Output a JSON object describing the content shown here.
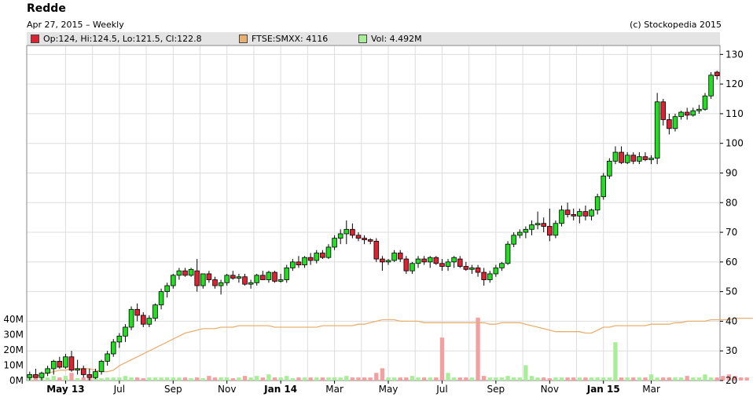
{
  "header": {
    "title": "Redde",
    "subtitle": "Apr 27, 2015 – Weekly",
    "copyright": "(c) Stockopedia 2015"
  },
  "legend": {
    "ohlc": "Op:124, Hi:124.5, Lo:121.5, Cl:122.8",
    "index": "FTSE:SMXX: 4116",
    "volume": "Vol: 4.492M"
  },
  "colors": {
    "up": "#22dd22",
    "down": "#dd2233",
    "index_line": "#e8b070",
    "vol_up": "#a8ee98",
    "vol_down": "#f4a0a0",
    "grid": "#dddddd",
    "legend_bg": "#e4e4e4"
  },
  "chart_data": {
    "type": "candlestick",
    "price_axis": {
      "ylim": [
        20,
        133
      ],
      "ticks": [
        20,
        30,
        40,
        50,
        60,
        70,
        80,
        90,
        100,
        110,
        120,
        130
      ],
      "position": "right"
    },
    "volume_axis": {
      "ylim": [
        0,
        45
      ],
      "ticks": [
        0,
        10,
        20,
        30,
        40
      ],
      "tick_labels": [
        "0M",
        "10M",
        "20M",
        "30M",
        "40M"
      ],
      "position": "left"
    },
    "x_labels": [
      "May 13",
      "Jul",
      "Sep",
      "Nov",
      "Jan 14",
      "Mar",
      "May",
      "Jul",
      "Sep",
      "Nov",
      "Jan 15",
      "Mar"
    ],
    "x_label_weeks": [
      6,
      15,
      24,
      33,
      42,
      51,
      60,
      69,
      78,
      87,
      96,
      104
    ],
    "bold_labels": [
      "May 13",
      "Jan 14",
      "Jan 15"
    ],
    "grid": true,
    "candles": [
      {
        "o": 21,
        "h": 23,
        "l": 20,
        "c": 22
      },
      {
        "o": 22,
        "h": 24,
        "l": 21,
        "c": 21
      },
      {
        "o": 21,
        "h": 23,
        "l": 20,
        "c": 22.5
      },
      {
        "o": 22.5,
        "h": 25,
        "l": 21.5,
        "c": 24
      },
      {
        "o": 24,
        "h": 27,
        "l": 22,
        "c": 26.5
      },
      {
        "o": 26.5,
        "h": 28,
        "l": 24,
        "c": 24.5
      },
      {
        "o": 24.5,
        "h": 29,
        "l": 24,
        "c": 28
      },
      {
        "o": 28,
        "h": 30,
        "l": 23,
        "c": 23.5
      },
      {
        "o": 23.5,
        "h": 27,
        "l": 22,
        "c": 24
      },
      {
        "o": 24,
        "h": 25,
        "l": 21,
        "c": 22
      },
      {
        "o": 22,
        "h": 24,
        "l": 20,
        "c": 21
      },
      {
        "o": 21,
        "h": 24,
        "l": 20.5,
        "c": 23
      },
      {
        "o": 23,
        "h": 27,
        "l": 22,
        "c": 26.5
      },
      {
        "o": 26.5,
        "h": 30,
        "l": 25,
        "c": 29
      },
      {
        "o": 29,
        "h": 34,
        "l": 28,
        "c": 33
      },
      {
        "o": 33,
        "h": 36,
        "l": 31,
        "c": 35
      },
      {
        "o": 35,
        "h": 39,
        "l": 33,
        "c": 38
      },
      {
        "o": 38,
        "h": 45,
        "l": 37,
        "c": 44
      },
      {
        "o": 44,
        "h": 46,
        "l": 40,
        "c": 42
      },
      {
        "o": 42,
        "h": 43,
        "l": 38,
        "c": 39
      },
      {
        "o": 39,
        "h": 42,
        "l": 38,
        "c": 41
      },
      {
        "o": 41,
        "h": 46,
        "l": 40,
        "c": 45.5
      },
      {
        "o": 45.5,
        "h": 51,
        "l": 44,
        "c": 50
      },
      {
        "o": 50,
        "h": 53,
        "l": 48,
        "c": 52
      },
      {
        "o": 52,
        "h": 56,
        "l": 51,
        "c": 55.5
      },
      {
        "o": 55.5,
        "h": 58,
        "l": 54,
        "c": 57
      },
      {
        "o": 57,
        "h": 58,
        "l": 55,
        "c": 55.5
      },
      {
        "o": 55.5,
        "h": 58,
        "l": 55,
        "c": 57.5
      },
      {
        "o": 57,
        "h": 61,
        "l": 50,
        "c": 52
      },
      {
        "o": 52,
        "h": 56,
        "l": 51,
        "c": 56
      },
      {
        "o": 56,
        "h": 57,
        "l": 53,
        "c": 54
      },
      {
        "o": 54,
        "h": 55,
        "l": 51,
        "c": 52
      },
      {
        "o": 52,
        "h": 54,
        "l": 49,
        "c": 53
      },
      {
        "o": 53,
        "h": 56,
        "l": 52,
        "c": 55.5
      },
      {
        "o": 55.5,
        "h": 57,
        "l": 54,
        "c": 54.5
      },
      {
        "o": 54.5,
        "h": 56,
        "l": 53,
        "c": 55
      },
      {
        "o": 55,
        "h": 56,
        "l": 52,
        "c": 52.5
      },
      {
        "o": 52.5,
        "h": 54,
        "l": 51,
        "c": 53
      },
      {
        "o": 53,
        "h": 56,
        "l": 52,
        "c": 55.5
      },
      {
        "o": 55.5,
        "h": 57,
        "l": 54,
        "c": 54
      },
      {
        "o": 54,
        "h": 57,
        "l": 53,
        "c": 56.5
      },
      {
        "o": 56.5,
        "h": 57,
        "l": 53,
        "c": 53.5
      },
      {
        "o": 53.5,
        "h": 56,
        "l": 53,
        "c": 54
      },
      {
        "o": 54,
        "h": 59,
        "l": 53,
        "c": 58
      },
      {
        "o": 58,
        "h": 61,
        "l": 57,
        "c": 60
      },
      {
        "o": 60,
        "h": 62,
        "l": 58,
        "c": 59
      },
      {
        "o": 59,
        "h": 62,
        "l": 58,
        "c": 61.5
      },
      {
        "o": 61.5,
        "h": 63,
        "l": 59,
        "c": 60.5
      },
      {
        "o": 60.5,
        "h": 64,
        "l": 59.5,
        "c": 63
      },
      {
        "o": 63,
        "h": 64,
        "l": 61,
        "c": 61.5
      },
      {
        "o": 61.5,
        "h": 66,
        "l": 61,
        "c": 65
      },
      {
        "o": 65,
        "h": 69,
        "l": 64,
        "c": 68
      },
      {
        "o": 68,
        "h": 71,
        "l": 66,
        "c": 69.5
      },
      {
        "o": 69.5,
        "h": 74,
        "l": 66,
        "c": 71
      },
      {
        "o": 71,
        "h": 73,
        "l": 68,
        "c": 69
      },
      {
        "o": 69,
        "h": 70,
        "l": 67,
        "c": 68
      },
      {
        "o": 68,
        "h": 69,
        "l": 66,
        "c": 67.5
      },
      {
        "o": 67.5,
        "h": 68,
        "l": 66,
        "c": 67
      },
      {
        "o": 67,
        "h": 68,
        "l": 60,
        "c": 61
      },
      {
        "o": 61,
        "h": 62,
        "l": 57,
        "c": 60
      },
      {
        "o": 60,
        "h": 61,
        "l": 59,
        "c": 60.5
      },
      {
        "o": 60.5,
        "h": 64,
        "l": 60,
        "c": 63
      },
      {
        "o": 63,
        "h": 64,
        "l": 60,
        "c": 61
      },
      {
        "o": 61,
        "h": 62,
        "l": 56,
        "c": 57
      },
      {
        "o": 57,
        "h": 60,
        "l": 56,
        "c": 59.5
      },
      {
        "o": 59.5,
        "h": 62,
        "l": 58,
        "c": 61
      },
      {
        "o": 61,
        "h": 62,
        "l": 59,
        "c": 60
      },
      {
        "o": 60,
        "h": 62,
        "l": 58,
        "c": 61.5
      },
      {
        "o": 61.5,
        "h": 62,
        "l": 59,
        "c": 59.5
      },
      {
        "o": 59.5,
        "h": 61,
        "l": 57,
        "c": 58.5
      },
      {
        "o": 58.5,
        "h": 61,
        "l": 57,
        "c": 60
      },
      {
        "o": 60,
        "h": 62,
        "l": 58,
        "c": 61.5
      },
      {
        "o": 61,
        "h": 62,
        "l": 58,
        "c": 58.5
      },
      {
        "o": 58.5,
        "h": 60,
        "l": 57,
        "c": 57.5
      },
      {
        "o": 57.5,
        "h": 59,
        "l": 56,
        "c": 58
      },
      {
        "o": 58,
        "h": 59,
        "l": 55,
        "c": 56.5
      },
      {
        "o": 56.5,
        "h": 58,
        "l": 52,
        "c": 54
      },
      {
        "o": 54,
        "h": 57,
        "l": 53,
        "c": 56
      },
      {
        "o": 56,
        "h": 59,
        "l": 55,
        "c": 58
      },
      {
        "o": 58,
        "h": 60,
        "l": 57,
        "c": 59.5
      },
      {
        "o": 59.5,
        "h": 67,
        "l": 59,
        "c": 66
      },
      {
        "o": 66,
        "h": 70,
        "l": 65,
        "c": 69
      },
      {
        "o": 69,
        "h": 71,
        "l": 68,
        "c": 70
      },
      {
        "o": 70,
        "h": 72,
        "l": 68,
        "c": 71
      },
      {
        "o": 71,
        "h": 74,
        "l": 69,
        "c": 72.5
      },
      {
        "o": 72.5,
        "h": 77,
        "l": 71,
        "c": 73
      },
      {
        "o": 73,
        "h": 75,
        "l": 70,
        "c": 72
      },
      {
        "o": 72,
        "h": 78,
        "l": 67,
        "c": 69
      },
      {
        "o": 69,
        "h": 74,
        "l": 68,
        "c": 73
      },
      {
        "o": 73,
        "h": 79,
        "l": 72,
        "c": 77.5
      },
      {
        "o": 77.5,
        "h": 80,
        "l": 75,
        "c": 76
      },
      {
        "o": 76,
        "h": 78,
        "l": 74,
        "c": 75.5
      },
      {
        "o": 75.5,
        "h": 78,
        "l": 73,
        "c": 77
      },
      {
        "o": 77,
        "h": 79,
        "l": 74,
        "c": 75.5
      },
      {
        "o": 75.5,
        "h": 78,
        "l": 74,
        "c": 77.5
      },
      {
        "o": 77.5,
        "h": 83,
        "l": 76,
        "c": 82
      },
      {
        "o": 82,
        "h": 90,
        "l": 81,
        "c": 89
      },
      {
        "o": 89,
        "h": 95,
        "l": 88,
        "c": 94
      },
      {
        "o": 94,
        "h": 99,
        "l": 93,
        "c": 97
      },
      {
        "o": 97,
        "h": 99,
        "l": 93,
        "c": 93.5
      },
      {
        "o": 93.5,
        "h": 97,
        "l": 93,
        "c": 96
      },
      {
        "o": 96,
        "h": 97,
        "l": 93,
        "c": 94
      },
      {
        "o": 94,
        "h": 97,
        "l": 93,
        "c": 95.5
      },
      {
        "o": 95.5,
        "h": 97,
        "l": 94,
        "c": 94.5
      },
      {
        "o": 94.5,
        "h": 96,
        "l": 93,
        "c": 95
      },
      {
        "o": 95,
        "h": 117,
        "l": 93,
        "c": 114
      },
      {
        "o": 114,
        "h": 115,
        "l": 106,
        "c": 108
      },
      {
        "o": 108,
        "h": 110,
        "l": 103,
        "c": 105
      },
      {
        "o": 105,
        "h": 110,
        "l": 104,
        "c": 109
      },
      {
        "o": 109,
        "h": 111,
        "l": 108,
        "c": 110.5
      },
      {
        "o": 110.5,
        "h": 112,
        "l": 108,
        "c": 109.5
      },
      {
        "o": 109.5,
        "h": 112,
        "l": 109,
        "c": 111
      },
      {
        "o": 111,
        "h": 113,
        "l": 110,
        "c": 111.5
      },
      {
        "o": 111.5,
        "h": 117,
        "l": 111,
        "c": 116
      },
      {
        "o": 116,
        "h": 124,
        "l": 115,
        "c": 123
      },
      {
        "o": 124,
        "h": 124.5,
        "l": 121.5,
        "c": 122.8
      }
    ],
    "volume": [
      3,
      2,
      1.5,
      2,
      3,
      2,
      3,
      5,
      1.5,
      2,
      1.5,
      2,
      1.5,
      2,
      2,
      2,
      3,
      2,
      2,
      1.5,
      2,
      2,
      2,
      2,
      2,
      2,
      2,
      1.5,
      2,
      1.5,
      3,
      2,
      2,
      2,
      1.5,
      2,
      3,
      2,
      3,
      2,
      4,
      2,
      2,
      3,
      1.5,
      2,
      2,
      2,
      2,
      2,
      2,
      2,
      2,
      3,
      2,
      2,
      2,
      2,
      5,
      8,
      2,
      2,
      2,
      2,
      3,
      2,
      2,
      2,
      2,
      28,
      5,
      2,
      2,
      2,
      2,
      41,
      3,
      2,
      2,
      2,
      3,
      2,
      2,
      10,
      3,
      2,
      2,
      1.5,
      2,
      2,
      2,
      2,
      2,
      2,
      2,
      2,
      2,
      2,
      25,
      2,
      2,
      2,
      2,
      2,
      4,
      2,
      2,
      2,
      2,
      2,
      3,
      2,
      2,
      4,
      2,
      2,
      3,
      4,
      3,
      2,
      2
    ],
    "index_line": [
      21,
      21.5,
      22,
      22.5,
      23,
      23.5,
      23.5,
      24,
      24,
      24,
      24,
      23.5,
      23,
      23,
      23.5,
      25,
      26,
      27,
      28,
      29,
      30,
      31,
      32,
      33,
      34,
      35,
      36,
      36.5,
      37,
      37.5,
      37.5,
      37.5,
      38,
      38,
      38,
      38.5,
      38.5,
      38.5,
      38.5,
      38.5,
      38.5,
      38,
      38,
      38,
      38,
      38,
      38,
      38,
      38,
      38.5,
      38.5,
      38.5,
      38.5,
      38.5,
      38.5,
      39,
      39,
      39.5,
      40,
      40.5,
      40.5,
      40.5,
      40,
      40,
      40,
      40,
      39.5,
      39.5,
      39.5,
      39.5,
      39.5,
      39.5,
      39.5,
      39.5,
      39.5,
      39.5,
      39.5,
      39,
      39,
      39.5,
      39.5,
      39.5,
      39.5,
      39,
      38.5,
      38,
      37.5,
      37,
      36.5,
      36.5,
      36.5,
      36.5,
      36.5,
      36,
      36,
      37,
      38,
      38,
      38.5,
      38.5,
      38.5,
      38.5,
      38.5,
      38.5,
      39,
      39,
      39,
      39,
      39.5,
      39.5,
      40,
      40,
      40,
      40,
      40.5,
      40.5,
      40.5,
      40.5,
      41,
      41,
      41,
      41
    ]
  }
}
